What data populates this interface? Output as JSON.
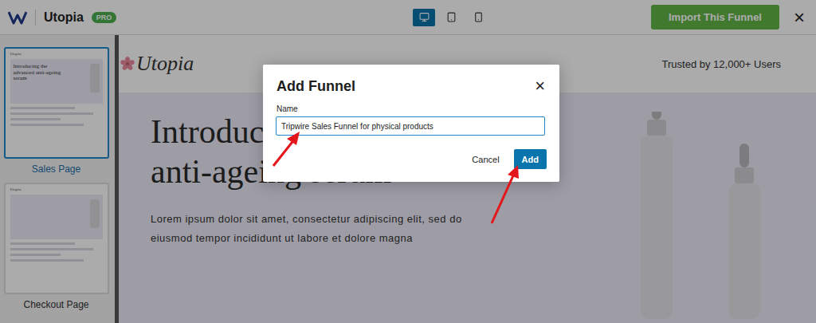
{
  "app": {
    "name": "Utopia",
    "badge": "PRO"
  },
  "devices": [
    {
      "kind": "desktop",
      "selected": true
    },
    {
      "kind": "tablet",
      "selected": false
    },
    {
      "kind": "mobile",
      "selected": false
    }
  ],
  "import_button": "Import This Funnel",
  "close": "×",
  "steps": [
    {
      "label": "Sales Page",
      "selected": true,
      "brand": "Utopia",
      "headline": "Introducing the advanced anti-ageing serum"
    },
    {
      "label": "Checkout Page",
      "selected": false,
      "brand": "Utopia",
      "headline": ""
    }
  ],
  "preview": {
    "logo": "Utopia",
    "tagline": "Trusted by 12,000+ Users",
    "headline": "Introducing the advanced anti-ageing serum",
    "body": "Lorem ipsum dolor sit amet, consectetur adipiscing elit, sed do eiusmod tempor incididunt ut labore et dolore magna"
  },
  "dialog": {
    "title": "Add Funnel",
    "close": "×",
    "field_label": "Name",
    "field_value": "Tripwire Sales Funnel for physical products",
    "buttons": [
      {
        "label": "Cancel",
        "kind": "secondary"
      },
      {
        "label": "Add",
        "kind": "primary"
      }
    ]
  }
}
